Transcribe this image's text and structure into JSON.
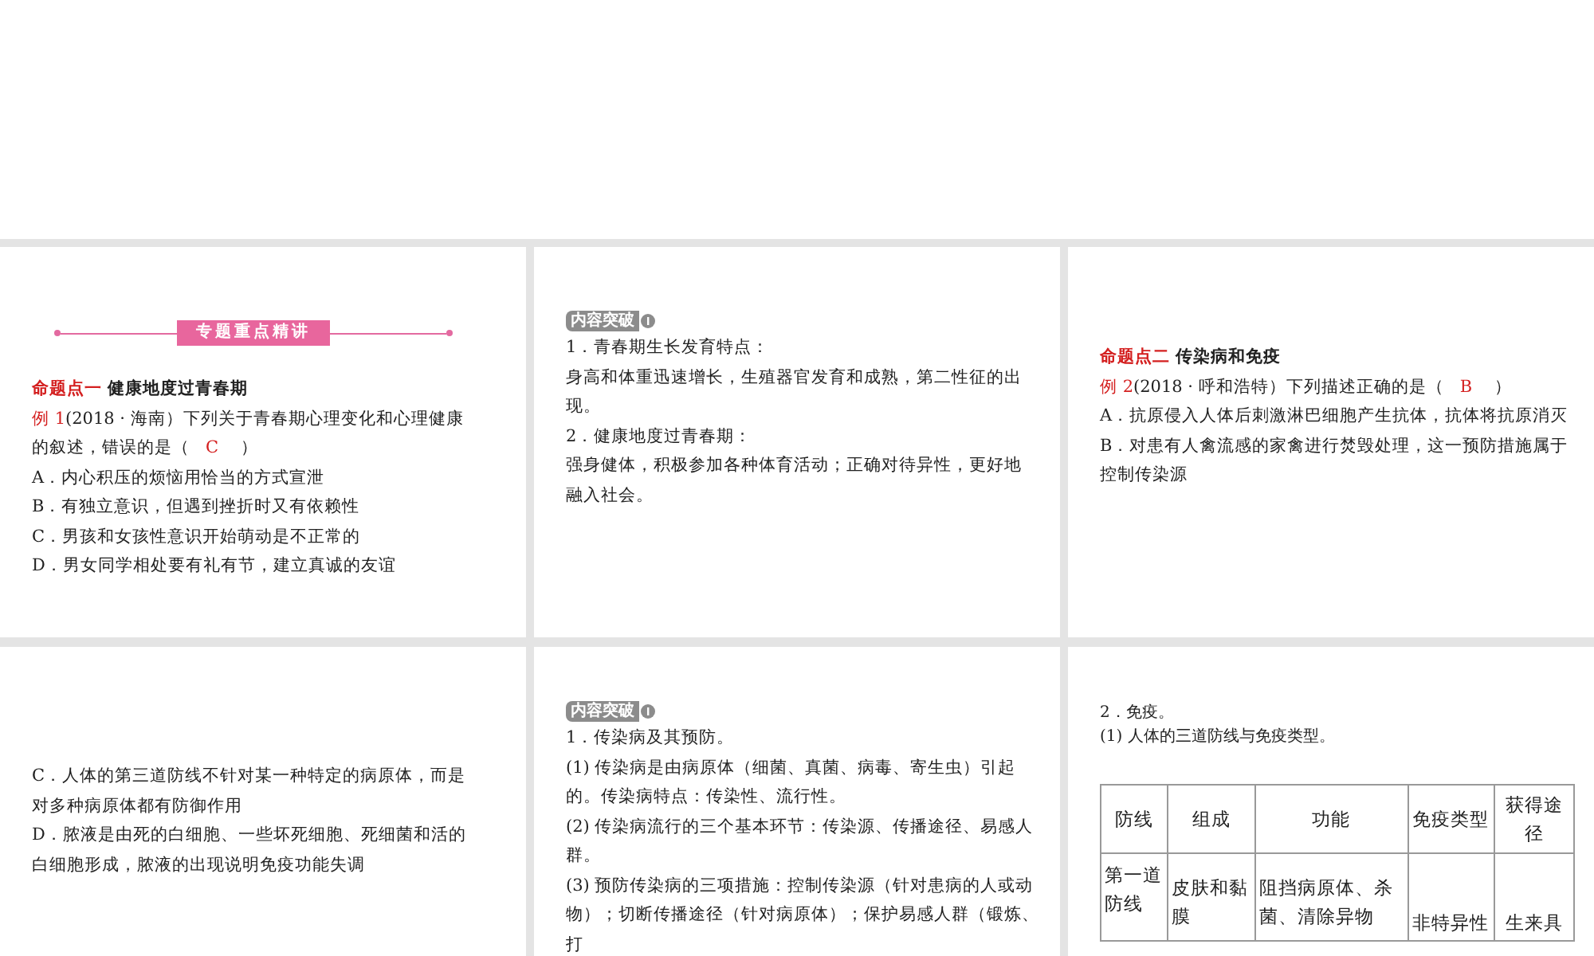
{
  "slides": [
    {
      "kind": "example",
      "banner": "专题重点精讲",
      "heading": {
        "label": "命题点一",
        "text": "健康地度过青春期"
      },
      "question": {
        "label": "例 1",
        "text": "(2018 · 海南）下列关于青春期心理变化和心理健康的叙述，错误的是（",
        "answer": "C",
        "close": "）"
      },
      "options": [
        "A．内心积压的烦恼用恰当的方式宣泄",
        "B．有独立意识，但遇到挫折时又有依赖性",
        "C．男孩和女孩性意识开始萌动是不正常的",
        "D．男女同学相处要有礼有节，建立真诚的友谊"
      ]
    },
    {
      "kind": "content",
      "badge": "内容突破",
      "paragraphs": [
        "1．青春期生长发育特点：",
        "身高和体重迅速增长，生殖器官发育和成熟，第二性征的出现。",
        "2．健康地度过青春期：",
        "强身健体，积极参加各种体育活动；正确对待异性，更好地融入社会。"
      ]
    },
    {
      "kind": "example",
      "heading": {
        "label": "命题点二",
        "text": "传染病和免疫"
      },
      "question": {
        "label": "例 2",
        "text": "(2018 · 呼和浩特）下列描述正确的是（",
        "answer": "B",
        "close": "）"
      },
      "options": [
        "A．抗原侵入人体后刺激淋巴细胞产生抗体，抗体将抗原消灭",
        "B．对患有人禽流感的家禽进行焚毁处理，这一预防措施属于控制传染源"
      ]
    },
    {
      "kind": "example",
      "options": [
        "C．人体的第三道防线不针对某一种特定的病原体，而是对多种病原体都有防御作用",
        "D．脓液是由死的白细胞、一些坏死细胞、死细菌和活的白细胞形成，脓液的出现说明免疫功能失调"
      ]
    },
    {
      "kind": "content",
      "badge": "内容突破",
      "paragraphs": [
        "1．传染病及其预防。",
        "(1) 传染病是由病原体（细菌、真菌、病毒、寄生虫）引起的。传染病特点：传染性、流行性。",
        "(2) 传染病流行的三个基本环节：传染源、传播途径、易感人群。",
        "(3) 预防传染病的三项措施：控制传染源（针对患病的人或动物）；切断传播途径（针对病原体）；保护易感人群（锻炼、打"
      ]
    },
    {
      "kind": "table",
      "paragraphs": [
        "2．免疫。",
        "(1) 人体的三道防线与免疫类型。"
      ],
      "table": {
        "columns": [
          "防线",
          "组成",
          "功能",
          "免疫类型",
          "获得途径"
        ],
        "rows": [
          [
            "第一道防线",
            "皮肤和黏膜",
            "阻挡病原体、杀菌、清除异物",
            "非特异性",
            "生来具"
          ]
        ]
      }
    }
  ]
}
